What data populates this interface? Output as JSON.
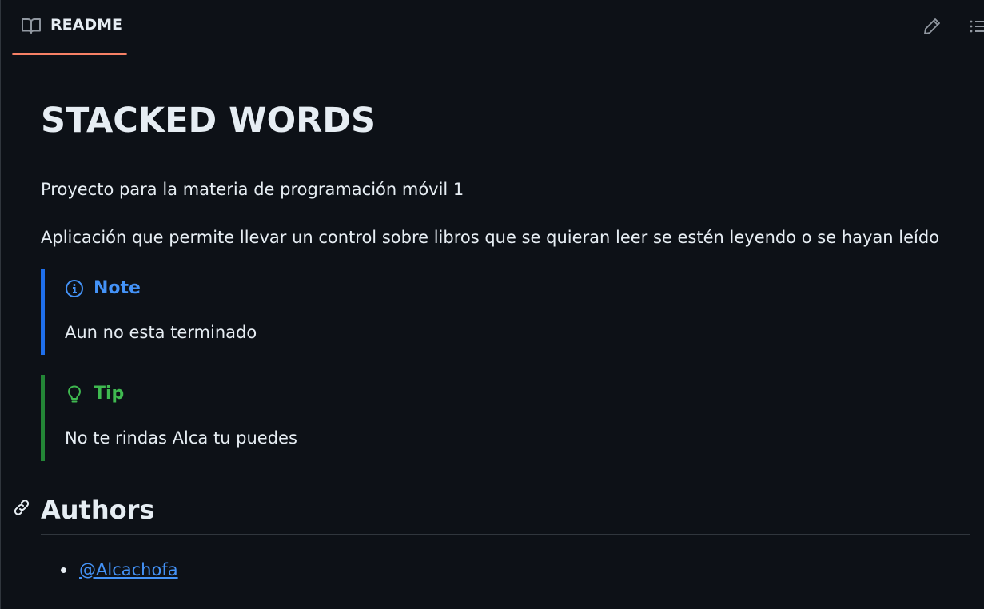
{
  "header": {
    "tab_label": "README",
    "tab_icon": "book-icon",
    "edit_icon": "pencil-icon",
    "toc_icon": "list-icon",
    "accent_color": "#f78166"
  },
  "readme": {
    "title": "STACKED WORDS",
    "paragraphs": [
      "Proyecto para la materia de programación móvil 1",
      "Aplicación que permite llevar un control sobre libros que se quieran leer se estén leyendo o se hayan leído"
    ],
    "alerts": [
      {
        "type": "note",
        "title": "Note",
        "body": "Aun no esta terminado",
        "icon": "info-icon",
        "color": "#4493f8"
      },
      {
        "type": "tip",
        "title": "Tip",
        "body": "No te rindas Alca tu puedes",
        "icon": "lightbulb-icon",
        "color": "#3fb950"
      }
    ],
    "authors_heading": "Authors",
    "authors": [
      "@Alcachofa"
    ],
    "link_color": "#4493f8"
  }
}
